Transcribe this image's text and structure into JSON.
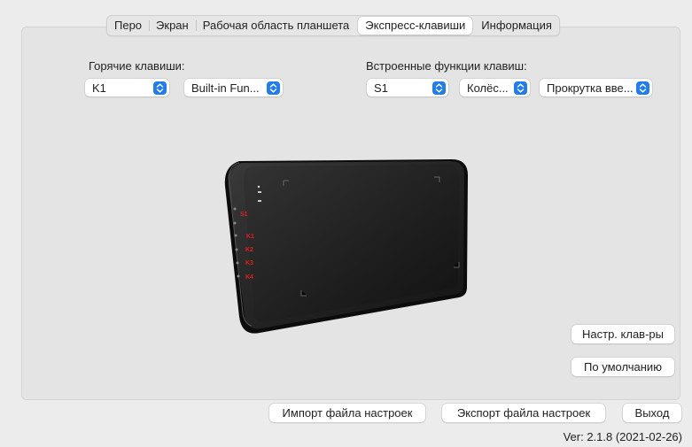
{
  "tabs": [
    {
      "label": "Перо",
      "active": false
    },
    {
      "label": "Экран",
      "active": false
    },
    {
      "label": "Рабочая область планшета",
      "active": false
    },
    {
      "label": "Экспресс-клавиши",
      "active": true
    },
    {
      "label": "Информация",
      "active": false
    }
  ],
  "hotkeys": {
    "label": "Горячие клавиши:",
    "key_value": "K1",
    "function_value": "Built-in Fun..."
  },
  "builtin": {
    "label": "Встроенные функции клавиш:",
    "key_value": "S1",
    "mode_value": "Колёс...",
    "action_value": "Прокрутка вве..."
  },
  "tablet": {
    "key_labels": [
      "S1",
      "K1",
      "K2",
      "K3",
      "K4"
    ],
    "label_color": "#e0201c"
  },
  "buttons": {
    "keyboard_settings": "Настр. клав-ры",
    "defaults": "По умолчанию",
    "import": "Импорт файла настроек",
    "export": "Экспорт файла настроек",
    "exit": "Выход"
  },
  "version": "Ver: 2.1.8 (2021-02-26)",
  "colors": {
    "accent": "#1f7cf5",
    "background": "#ececec",
    "panel": "#e4e4e4"
  }
}
